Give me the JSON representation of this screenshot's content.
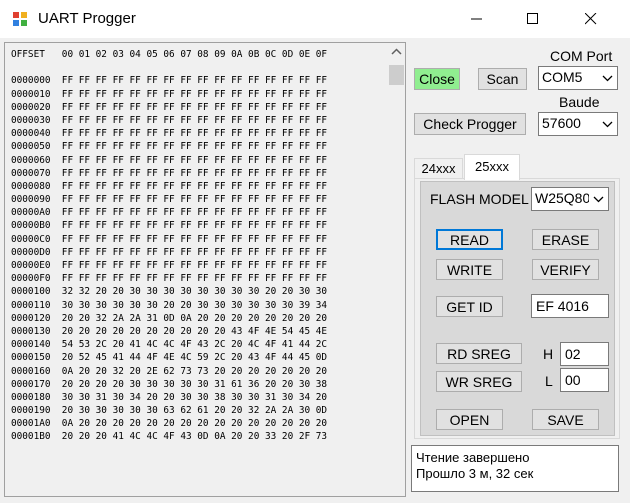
{
  "window": {
    "title": "UART Progger"
  },
  "hex": {
    "lines": [
      "OFFSET   00 01 02 03 04 05 06 07 08 09 0A 0B 0C 0D 0E 0F",
      "",
      "0000000  FF FF FF FF FF FF FF FF FF FF FF FF FF FF FF FF",
      "0000010  FF FF FF FF FF FF FF FF FF FF FF FF FF FF FF FF",
      "0000020  FF FF FF FF FF FF FF FF FF FF FF FF FF FF FF FF",
      "0000030  FF FF FF FF FF FF FF FF FF FF FF FF FF FF FF FF",
      "0000040  FF FF FF FF FF FF FF FF FF FF FF FF FF FF FF FF",
      "0000050  FF FF FF FF FF FF FF FF FF FF FF FF FF FF FF FF",
      "0000060  FF FF FF FF FF FF FF FF FF FF FF FF FF FF FF FF",
      "0000070  FF FF FF FF FF FF FF FF FF FF FF FF FF FF FF FF",
      "0000080  FF FF FF FF FF FF FF FF FF FF FF FF FF FF FF FF",
      "0000090  FF FF FF FF FF FF FF FF FF FF FF FF FF FF FF FF",
      "00000A0  FF FF FF FF FF FF FF FF FF FF FF FF FF FF FF FF",
      "00000B0  FF FF FF FF FF FF FF FF FF FF FF FF FF FF FF FF",
      "00000C0  FF FF FF FF FF FF FF FF FF FF FF FF FF FF FF FF",
      "00000D0  FF FF FF FF FF FF FF FF FF FF FF FF FF FF FF FF",
      "00000E0  FF FF FF FF FF FF FF FF FF FF FF FF FF FF FF FF",
      "00000F0  FF FF FF FF FF FF FF FF FF FF FF FF FF FF FF FF",
      "0000100  32 32 20 20 30 30 30 30 30 30 30 30 20 20 30 30",
      "0000110  30 30 30 30 30 30 20 20 30 30 30 30 30 30 39 34",
      "0000120  20 20 32 2A 2A 31 0D 0A 20 20 20 20 20 20 20 20",
      "0000130  20 20 20 20 20 20 20 20 20 20 43 4F 4E 54 45 4E",
      "0000140  54 53 2C 20 41 4C 4C 4F 43 2C 20 4C 4F 41 44 2C",
      "0000150  20 52 45 41 44 4F 4E 4C 59 2C 20 43 4F 44 45 0D",
      "0000160  0A 20 20 32 20 2E 62 73 73 20 20 20 20 20 20 20",
      "0000170  20 20 20 20 30 30 30 30 30 31 61 36 20 20 30 38",
      "0000180  30 30 31 30 34 20 20 30 30 38 30 30 31 30 34 20",
      "0000190  20 30 30 30 30 30 63 62 61 20 20 32 2A 2A 30 0D",
      "00001A0  0A 20 20 20 20 20 20 20 20 20 20 20 20 20 20 20",
      "00001B0  20 20 20 41 4C 4C 4F 43 0D 0A 20 20 33 20 2F 73"
    ]
  },
  "controls": {
    "close": "Close",
    "scan": "Scan",
    "check": "Check Progger",
    "com_label": "COM Port",
    "com_value": "COM5",
    "baud_label": "Baude",
    "baud_value": "57600"
  },
  "tabs": [
    "24xxx",
    "25xxx"
  ],
  "flash": {
    "model_label": "FLASH MODEL",
    "model_value": "W25Q80",
    "read": "READ",
    "erase": "ERASE",
    "write": "WRITE",
    "verify": "VERIFY",
    "get_id": "GET ID",
    "id_value": "EF 4016",
    "rd_sreg": "RD SREG",
    "h_label": "H",
    "h_value": "02",
    "wr_sreg": "WR SREG",
    "l_label": "L",
    "l_value": "00",
    "open": "OPEN",
    "save": "SAVE"
  },
  "status": {
    "line1": "Чтение завершено",
    "line2": "Прошло 3 м, 32 сек"
  },
  "colors": {
    "close_button": "#90ee90",
    "focus_border": "#0078d7",
    "window_bg": "#f0f0f0",
    "panel_bg": "#d9d9d9"
  }
}
